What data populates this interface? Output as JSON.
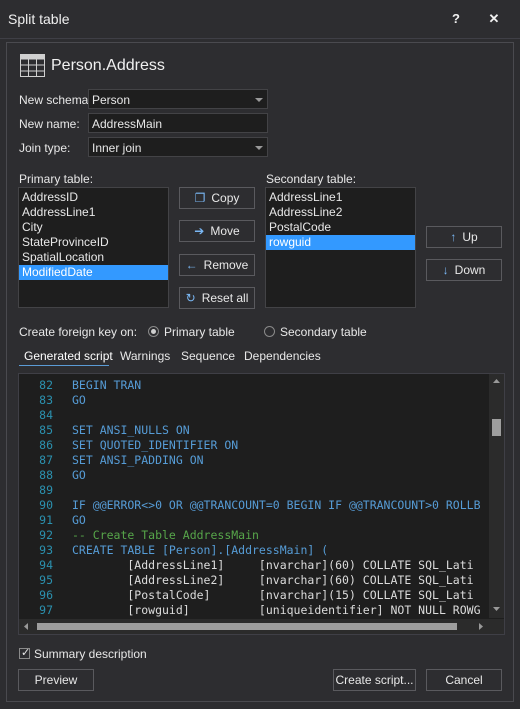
{
  "window": {
    "title": "Split table",
    "help_label": "?",
    "close_label": "✕"
  },
  "header": {
    "table_name": "Person.Address",
    "icon": "table-icon"
  },
  "form": {
    "new_schema_label": "New schema:",
    "new_schema_value": "Person",
    "new_name_label": "New name:",
    "new_name_value": "AddressMain",
    "join_type_label": "Join type:",
    "join_type_value": "Inner join"
  },
  "primary": {
    "label": "Primary table:",
    "items": [
      "AddressID",
      "AddressLine1",
      "City",
      "StateProvinceID",
      "SpatialLocation",
      "ModifiedDate"
    ],
    "selected": "ModifiedDate"
  },
  "secondary": {
    "label": "Secondary table:",
    "items": [
      "AddressLine1",
      "AddressLine2",
      "PostalCode",
      "rowguid"
    ],
    "selected": "rowguid"
  },
  "buttons": {
    "copy": "Copy",
    "move": "Move",
    "remove": "Remove",
    "reset_all": "Reset all",
    "up": "Up",
    "down": "Down",
    "preview": "Preview",
    "create_script": "Create script...",
    "cancel": "Cancel"
  },
  "foreign_key": {
    "label": "Create foreign key on:",
    "option_primary": "Primary table",
    "option_secondary": "Secondary table",
    "selected": "Primary table"
  },
  "tabs": [
    "Generated script",
    "Warnings",
    "Sequence",
    "Dependencies"
  ],
  "active_tab": "Generated script",
  "script_lines": [
    {
      "num": "82",
      "text": "BEGIN TRAN"
    },
    {
      "num": "83",
      "text": "GO"
    },
    {
      "num": "84",
      "text": ""
    },
    {
      "num": "85",
      "text": "SET ANSI_NULLS ON"
    },
    {
      "num": "86",
      "text": "SET QUOTED_IDENTIFIER ON"
    },
    {
      "num": "87",
      "text": "SET ANSI_PADDING ON"
    },
    {
      "num": "88",
      "text": "GO"
    },
    {
      "num": "89",
      "text": ""
    },
    {
      "num": "90",
      "text": "IF @@ERROR<>0 OR @@TRANCOUNT=0 BEGIN IF @@TRANCOUNT>0 ROLLB"
    },
    {
      "num": "91",
      "text": "GO"
    },
    {
      "num": "92",
      "text": "-- Create Table AddressMain"
    },
    {
      "num": "93",
      "text": "CREATE TABLE [Person].[AddressMain] ("
    },
    {
      "num": "94",
      "text": "        [AddressLine1]     [nvarchar](60) COLLATE SQL_Lati"
    },
    {
      "num": "95",
      "text": "        [AddressLine2]     [nvarchar](60) COLLATE SQL_Lati"
    },
    {
      "num": "96",
      "text": "        [PostalCode]       [nvarchar](15) COLLATE SQL_Lati"
    },
    {
      "num": "97",
      "text": "        [rowguid]          [uniqueidentifier] NOT NULL ROWG"
    }
  ],
  "summary": {
    "label": "Summary description",
    "checked": true
  },
  "colors": {
    "selection": "#3399ff",
    "keyword": "#569cd6",
    "comment": "#57a64a",
    "line_number": "#2b91af"
  }
}
